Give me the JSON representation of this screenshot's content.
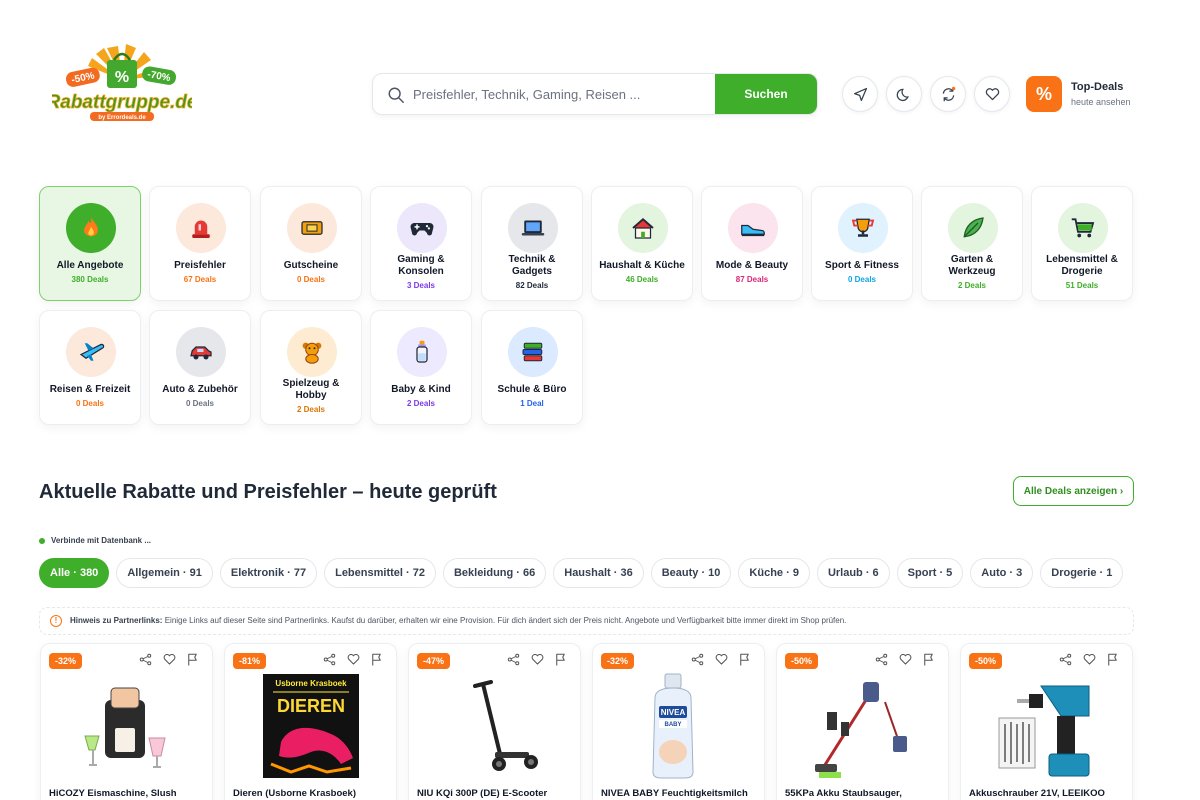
{
  "brand": {
    "logo_text": "Rabattgruppe.de",
    "logo_sub": "by Errordeals.de",
    "logo_left_tag": "-50%",
    "logo_right_tag": "-70%"
  },
  "search": {
    "placeholder": "Preisfehler, Technik, Gaming, Reisen ...",
    "button_label": "Suchen"
  },
  "top_deals": {
    "title": "Top-Deals",
    "subtitle": "heute ansehen"
  },
  "categories": [
    {
      "label": "Alle Angebote",
      "count": "380 Deals",
      "icon": "fire-icon",
      "color": "#3fae2a"
    },
    {
      "label": "Preisfehler",
      "count": "67 Deals",
      "icon": "siren-icon",
      "color": "#f97316"
    },
    {
      "label": "Gutscheine",
      "count": "0 Deals",
      "icon": "ticket-icon",
      "color": "#f97316"
    },
    {
      "label": "Gaming & Konsolen",
      "count": "3 Deals",
      "icon": "gamepad-icon",
      "color": "#7c3aed"
    },
    {
      "label": "Technik & Gadgets",
      "count": "82 Deals",
      "icon": "laptop-icon",
      "color": "#1f2937"
    },
    {
      "label": "Haushalt & Küche",
      "count": "46 Deals",
      "icon": "house-icon",
      "color": "#3fae2a"
    },
    {
      "label": "Mode & Beauty",
      "count": "87 Deals",
      "icon": "shoe-icon",
      "color": "#db2777"
    },
    {
      "label": "Sport & Fitness",
      "count": "0 Deals",
      "icon": "trophy-icon",
      "color": "#0ea5e9"
    },
    {
      "label": "Garten & Werkzeug",
      "count": "2 Deals",
      "icon": "leaf-icon",
      "color": "#3fae2a"
    },
    {
      "label": "Lebensmittel & Drogerie",
      "count": "51 Deals",
      "icon": "cart-icon",
      "color": "#3fae2a"
    },
    {
      "label": "Reisen & Freizeit",
      "count": "0 Deals",
      "icon": "plane-icon",
      "color": "#f97316"
    },
    {
      "label": "Auto & Zubehör",
      "count": "0 Deals",
      "icon": "car-icon",
      "color": "#6b7280"
    },
    {
      "label": "Spielzeug & Hobby",
      "count": "2 Deals",
      "icon": "teddy-icon",
      "color": "#d97706"
    },
    {
      "label": "Baby & Kind",
      "count": "2 Deals",
      "icon": "bottle-icon",
      "color": "#7c3aed"
    },
    {
      "label": "Schule & Büro",
      "count": "1 Deal",
      "icon": "books-icon",
      "color": "#2563eb"
    }
  ],
  "section": {
    "title": "Aktuelle Rabatte und Preisfehler – heute geprüft",
    "all_deals_button": "Alle Deals anzeigen ›",
    "status_text": "Verbinde mit Datenbank ..."
  },
  "filters": [
    {
      "label": "Alle · 380",
      "active": true
    },
    {
      "label": "Allgemein · 91"
    },
    {
      "label": "Elektronik · 77"
    },
    {
      "label": "Lebensmittel · 72"
    },
    {
      "label": "Bekleidung · 66"
    },
    {
      "label": "Haushalt · 36"
    },
    {
      "label": "Beauty · 10"
    },
    {
      "label": "Küche · 9"
    },
    {
      "label": "Urlaub · 6"
    },
    {
      "label": "Sport · 5"
    },
    {
      "label": "Auto · 3"
    },
    {
      "label": "Drogerie · 1"
    }
  ],
  "hint": {
    "label": "Hinweis zu Partnerlinks:",
    "text": "Einige Links auf dieser Seite sind Partnerlinks. Kaufst du darüber, erhalten wir eine Provision. Für dich ändert sich der Preis nicht. Angebote und Verfügbarkeit bitte immer direkt im Shop prüfen."
  },
  "products": [
    {
      "discount": "-32%",
      "name": "HiCOZY Eismaschine, Slush",
      "image": "ice-machine"
    },
    {
      "discount": "-81%",
      "name": "Dieren (Usborne Krasboek)",
      "image": "book-dieren",
      "book_series": "Usborne Krasboek",
      "book_title": "DIEREN"
    },
    {
      "discount": "-47%",
      "name": "NIU KQi 300P (DE) E-Scooter",
      "image": "e-scooter"
    },
    {
      "discount": "-32%",
      "name": "NIVEA BABY Feuchtigkeitsmilch",
      "image": "nivea-bottle",
      "brand_on_pack": "NIVEA",
      "pack_sub": "BABY"
    },
    {
      "discount": "-50%",
      "name": "55KPa Akku Staubsauger,",
      "image": "vacuum"
    },
    {
      "discount": "-50%",
      "name": "Akkuschrauber 21V, LEEIKOO",
      "image": "drill"
    }
  ]
}
